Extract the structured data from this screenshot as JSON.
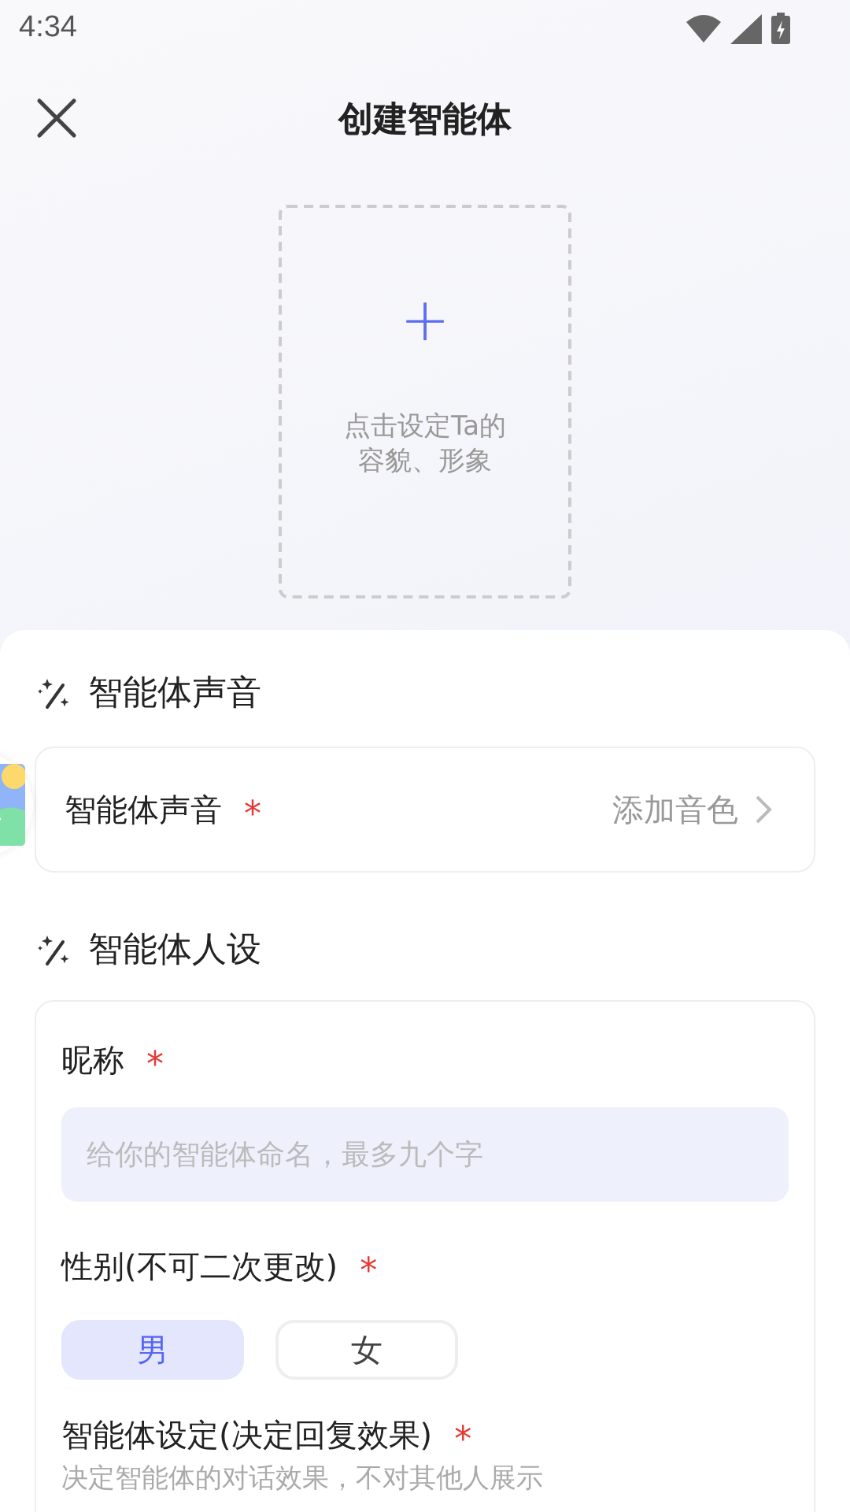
{
  "status_bar": {
    "time": "4:34"
  },
  "header": {
    "title": "创建智能体"
  },
  "avatar_upload": {
    "icon": "+",
    "hint_lines": [
      "点击设定Ta的",
      "容貌、形象"
    ]
  },
  "voice_section": {
    "title": "智能体声音",
    "row": {
      "label": "智能体声音",
      "required_mark": "*",
      "value": "添加音色"
    }
  },
  "persona_section": {
    "title": "智能体人设",
    "nickname": {
      "label": "昵称",
      "required_mark": "*",
      "placeholder": "给你的智能体命名，最多九个字"
    },
    "gender": {
      "label": "性别(不可二次更改)",
      "required_mark": "*",
      "options": [
        {
          "label": "男",
          "selected": true
        },
        {
          "label": "女",
          "selected": false
        }
      ]
    },
    "setting": {
      "label": "智能体设定(决定回复效果)",
      "required_mark": "*",
      "hint": "决定智能体的对话效果，不对其他人展示"
    }
  }
}
